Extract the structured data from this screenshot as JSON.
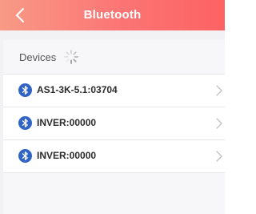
{
  "header": {
    "title": "Bluetooth",
    "back_icon": "chevron-left-icon",
    "gradient_start": "#f89a86",
    "gradient_end": "#fd6262"
  },
  "devices_section": {
    "title": "Devices",
    "loading_icon": "loading-spinner-icon"
  },
  "devices": [
    {
      "name": "AS1-3K-5.1:03704",
      "icon": "bluetooth-icon"
    },
    {
      "name": "INVER:00000",
      "icon": "bluetooth-icon"
    },
    {
      "name": "INVER:00000",
      "icon": "bluetooth-icon"
    }
  ],
  "colors": {
    "bluetooth_accent": "#2f63c6",
    "background": "#f2f2f4"
  }
}
